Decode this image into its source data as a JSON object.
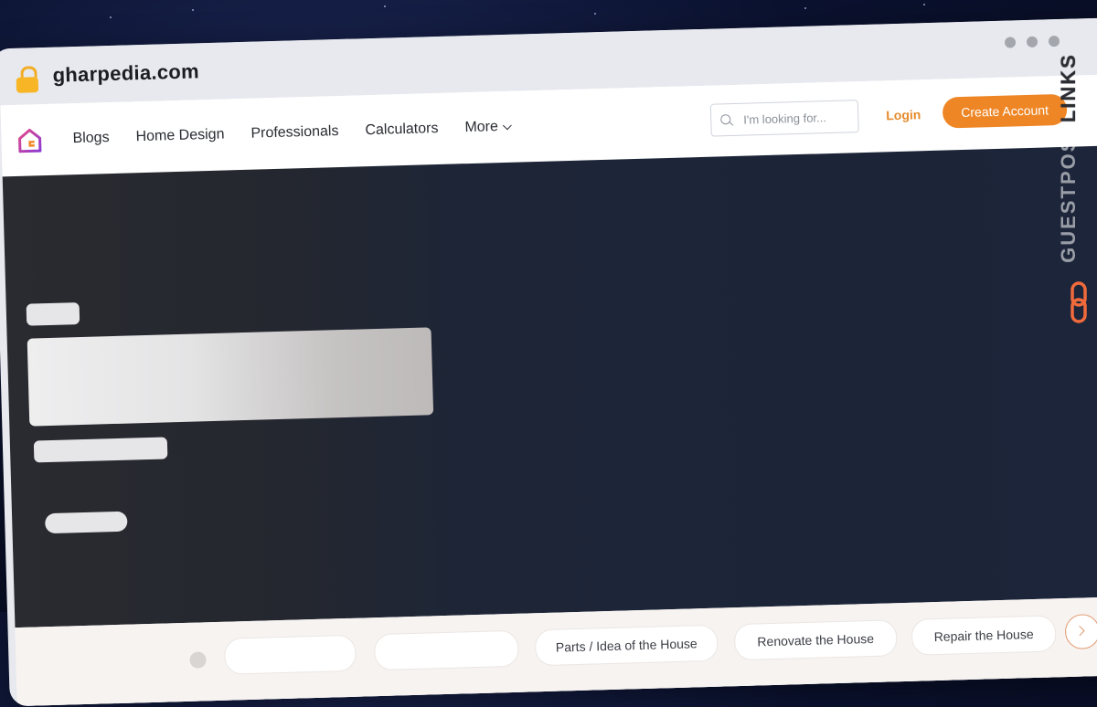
{
  "browser": {
    "url": "gharpedia.com"
  },
  "nav": {
    "items": [
      {
        "label": "Blogs"
      },
      {
        "label": "Home Design"
      },
      {
        "label": "Professionals"
      },
      {
        "label": "Calculators"
      },
      {
        "label": "More"
      }
    ],
    "search_placeholder": "I'm looking for...",
    "login": "Login",
    "create_account": "Create Account"
  },
  "chips": [
    {
      "label": "Parts / Idea of the House"
    },
    {
      "label": "Renovate the House"
    },
    {
      "label": "Repair the House"
    }
  ],
  "watermark": {
    "text_guest": "GUESTPOST",
    "text_links": "LINKS"
  },
  "colors": {
    "accent": "#ee8626",
    "hero_bg": "#1c2539",
    "login": "#e58a2a"
  }
}
